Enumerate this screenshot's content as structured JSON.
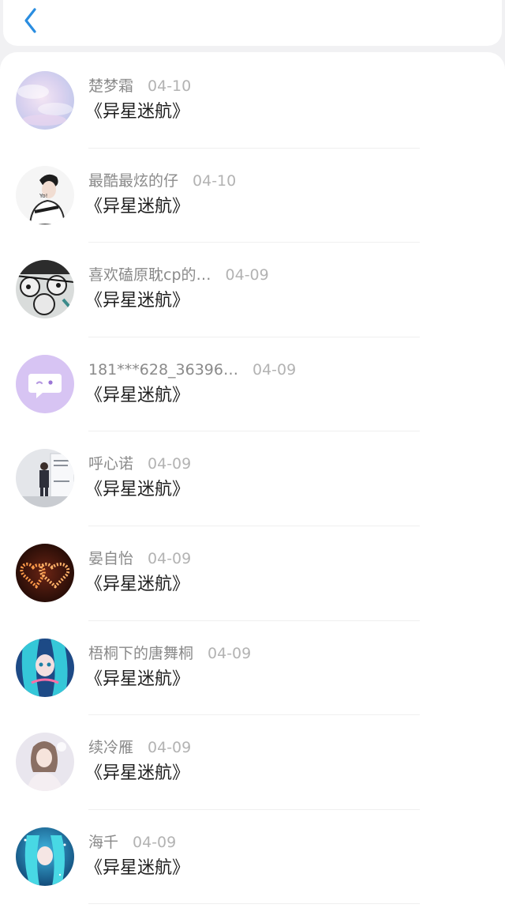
{
  "header": {
    "back_icon": "chevron-left-icon",
    "accent": "#2a8de0"
  },
  "items": [
    {
      "name": "楚梦霜",
      "date": "04-10",
      "title": "《异星迷航》",
      "avatar": "pastel-clouds"
    },
    {
      "name": "最酷最炫的仔",
      "date": "04-10",
      "title": "《异星迷航》",
      "avatar": "anime-boy"
    },
    {
      "name": "喜欢磕原耽cp的…",
      "date": "04-09",
      "title": "《异星迷航》",
      "avatar": "manga-group"
    },
    {
      "name": "181***628_36396…",
      "date": "04-09",
      "title": "《异星迷航》",
      "avatar": "default-chat"
    },
    {
      "name": "呼心诺",
      "date": "04-09",
      "title": "《异星迷航》",
      "avatar": "fashion-poster"
    },
    {
      "name": "晏自怡",
      "date": "04-09",
      "title": "《异星迷航》",
      "avatar": "candle-hearts"
    },
    {
      "name": "梧桐下的唐舞桐",
      "date": "04-09",
      "title": "《异星迷航》",
      "avatar": "anime-blue-girl"
    },
    {
      "name": "续冷雁",
      "date": "04-09",
      "title": "《异星迷航》",
      "avatar": "portrait-girl"
    },
    {
      "name": "海千",
      "date": "04-09",
      "title": "《异星迷航》",
      "avatar": "anime-teal-girl"
    }
  ]
}
